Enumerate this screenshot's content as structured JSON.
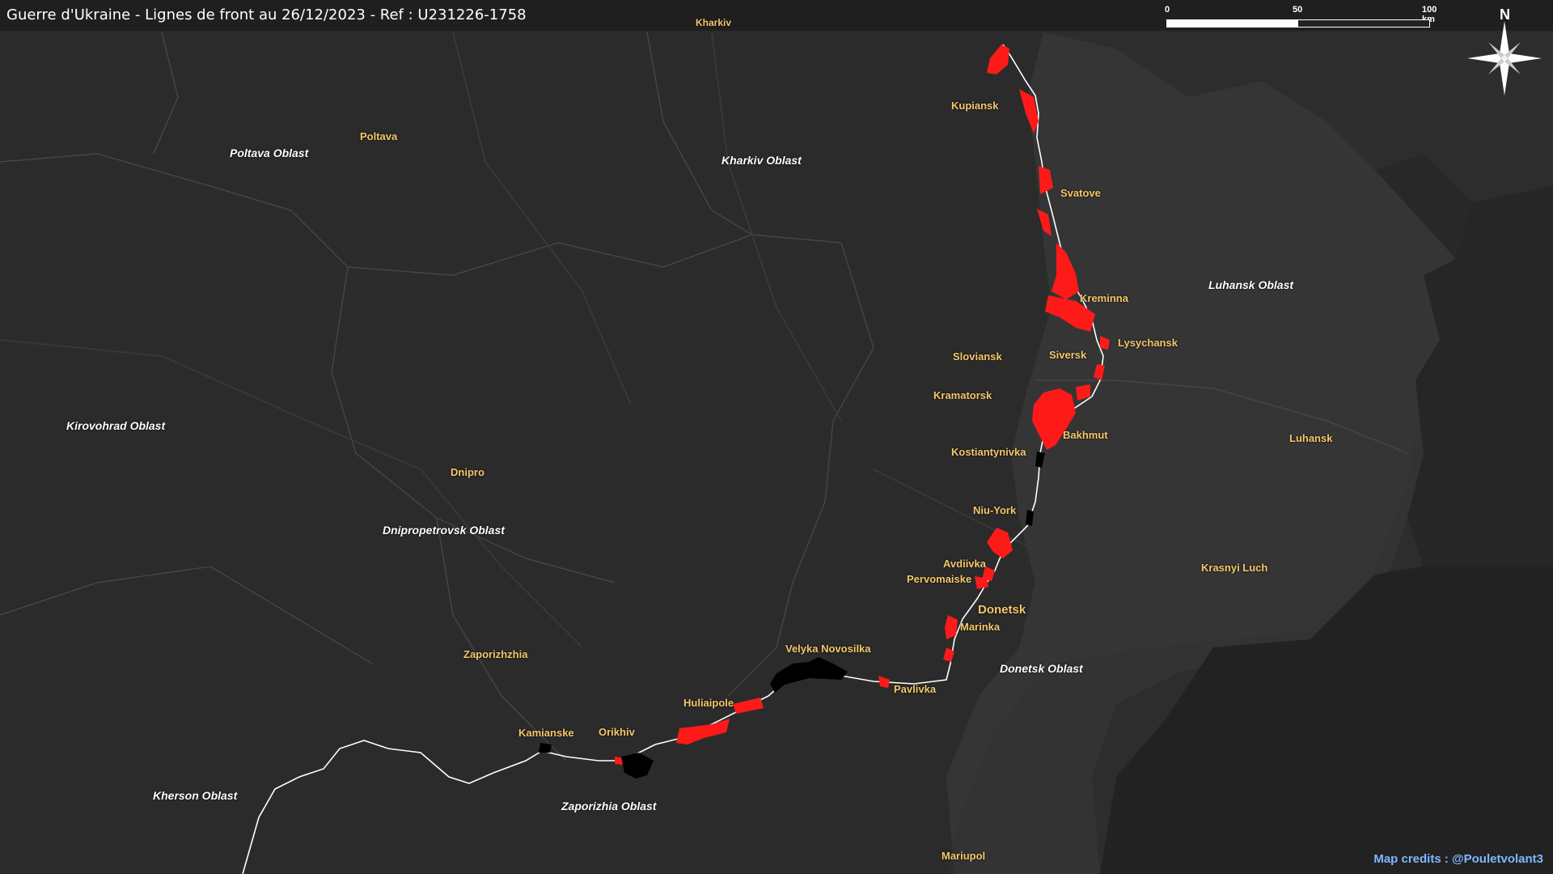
{
  "title": "Guerre d'Ukraine - Lignes de front au 26/12/2023 - Ref : U231226-1758",
  "credits": "Map credits : @Pouletvolant3",
  "scale_bar": {
    "labels": [
      "0",
      "50",
      "100 km"
    ]
  },
  "north_arrow": {
    "label": "N",
    "icon": "compass-rose-icon"
  },
  "colors": {
    "background": "#2b2b2b",
    "region_light": "#3a3a3a",
    "occupied_zone": "#323232",
    "front_gain": "#ff1a1a",
    "liberated": "#000000",
    "front_line": "#ffffff",
    "city_label": "#f5c86b",
    "oblast_label": "#ffffff",
    "credits": "#7fb7ff"
  },
  "cities": [
    {
      "id": "kharkiv",
      "label": "Kharkiv"
    },
    {
      "id": "kupiansk",
      "label": "Kupiansk"
    },
    {
      "id": "poltava",
      "label": "Poltava"
    },
    {
      "id": "svatove",
      "label": "Svatove"
    },
    {
      "id": "kreminna",
      "label": "Kreminna"
    },
    {
      "id": "lysychansk",
      "label": "Lysychansk"
    },
    {
      "id": "sloviansk",
      "label": "Sloviansk"
    },
    {
      "id": "siversk",
      "label": "Siversk"
    },
    {
      "id": "kramatorsk",
      "label": "Kramatorsk"
    },
    {
      "id": "bakhmut",
      "label": "Bakhmut"
    },
    {
      "id": "luhansk",
      "label": "Luhansk"
    },
    {
      "id": "kostiantynivka",
      "label": "Kostiantynivka"
    },
    {
      "id": "dnipro",
      "label": "Dnipro"
    },
    {
      "id": "niu-york",
      "label": "Niu-York"
    },
    {
      "id": "avdiivka",
      "label": "Avdiivka"
    },
    {
      "id": "pervomaiske",
      "label": "Pervomaiske"
    },
    {
      "id": "krasnyi-luch",
      "label": "Krasnyi Luch"
    },
    {
      "id": "donetsk",
      "label": "Donetsk"
    },
    {
      "id": "marinka",
      "label": "Marinka"
    },
    {
      "id": "zaporizhzhia",
      "label": "Zaporizhzhia"
    },
    {
      "id": "velyka-novosilka",
      "label": "Velyka Novosilka"
    },
    {
      "id": "pavlivka",
      "label": "Pavlivka"
    },
    {
      "id": "huliaipole",
      "label": "Huliaipole"
    },
    {
      "id": "kamianske",
      "label": "Kamianske"
    },
    {
      "id": "orikhiv",
      "label": "Orikhiv"
    },
    {
      "id": "mariupol",
      "label": "Mariupol"
    }
  ],
  "oblasts": [
    {
      "id": "poltava-oblast",
      "label": "Poltava Oblast"
    },
    {
      "id": "kharkiv-oblast",
      "label": "Kharkiv Oblast"
    },
    {
      "id": "luhansk-oblast",
      "label": "Luhansk Oblast"
    },
    {
      "id": "kirovohrad-oblast",
      "label": "Kirovohrad Oblast"
    },
    {
      "id": "dnipropetrovsk-oblast",
      "label": "Dnipropetrovsk Oblast"
    },
    {
      "id": "donetsk-oblast",
      "label": "Donetsk Oblast"
    },
    {
      "id": "kherson-oblast",
      "label": "Kherson Oblast"
    },
    {
      "id": "zaporizhia-oblast",
      "label": "Zaporizhia Oblast"
    }
  ]
}
